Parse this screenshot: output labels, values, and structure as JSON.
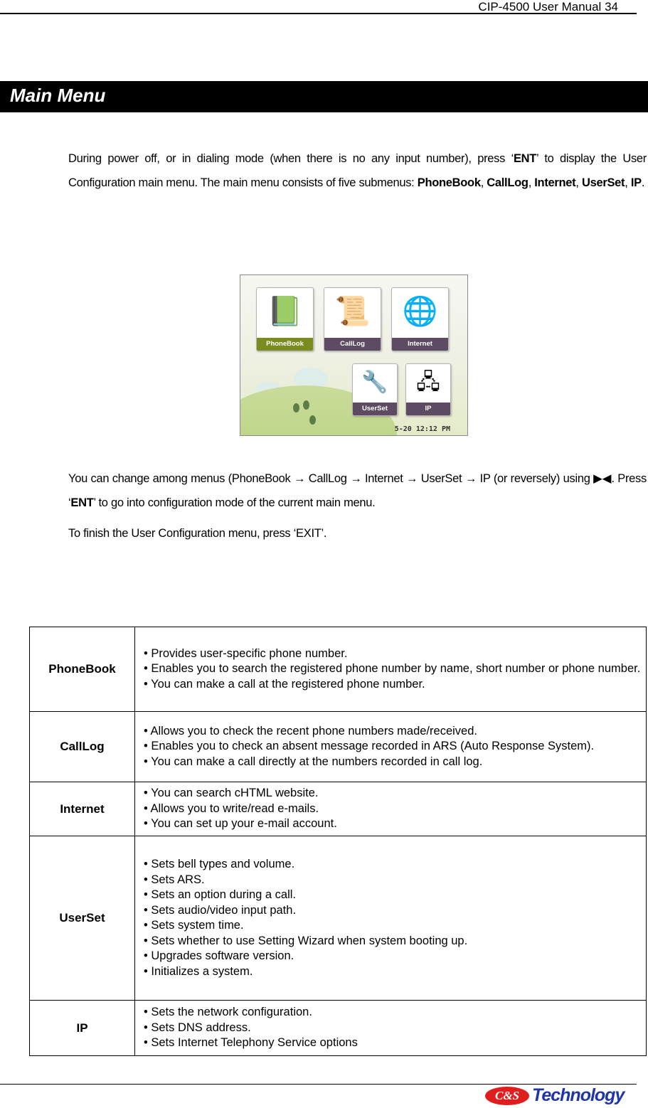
{
  "header": {
    "title": "CIP-4500 User Manual",
    "page_number": "34"
  },
  "section": {
    "title": "Main Menu"
  },
  "intro": {
    "part1": "During power off, or in dialing mode (when there is no any input number), press ‘",
    "key": "ENT",
    "part2": "’ to display the User Configuration main menu. The main menu consists of five submenus: ",
    "submenus": [
      "PhoneBook",
      "CallLog",
      "Internet",
      "UserSet",
      "IP"
    ],
    "sep": ", ",
    "end": "."
  },
  "screenshot": {
    "tiles": [
      {
        "label": "PhoneBook",
        "icon": "notebook-icon",
        "glyph": "📗",
        "active": true
      },
      {
        "label": "CallLog",
        "icon": "scroll-icon",
        "glyph": "📜",
        "active": false
      },
      {
        "label": "Internet",
        "icon": "globe-icon",
        "glyph": "🌐",
        "active": false
      },
      {
        "label": "UserSet",
        "icon": "wrench-icon",
        "glyph": "🔧",
        "active": false
      },
      {
        "label": "IP",
        "icon": "network-icon",
        "glyph": "🖧",
        "active": false
      }
    ],
    "clock": "5-20 12:12 PM",
    "colors": {
      "active_label": "#7a8c1e",
      "inactive_label": "#5c4b63"
    }
  },
  "navigation": {
    "part1": "You can change among menus (PhoneBook ",
    "arrow": "→",
    "seq": [
      "CallLog",
      "Internet",
      "UserSet"
    ],
    "part_ip": " IP (or reversely) using ",
    "nav_keys": "▶◀",
    "part2": ". Press ‘",
    "key": "ENT",
    "part3": "’ to go into configuration mode of the current main menu."
  },
  "exit_note": "To finish the User Configuration menu, press ‘EXIT’.",
  "table": {
    "bullet": "•",
    "rows": [
      {
        "name": "PhoneBook",
        "items": [
          "Provides user-specific phone number.",
          "Enables you to search the registered phone number by name, short number or phone number.",
          "You can make a call at the registered phone number."
        ]
      },
      {
        "name": "CallLog",
        "items": [
          "Allows you to check the recent phone numbers made/received.",
          "Enables you to check an absent message recorded in ARS (Auto Response System).",
          "You can make a call directly at the numbers recorded in call log."
        ]
      },
      {
        "name": "Internet",
        "items": [
          "You can search cHTML website.",
          "Allows you to write/read e-mails.",
          "You can set up your e-mail account."
        ]
      },
      {
        "name": "UserSet",
        "items": [
          "Sets bell types and volume.",
          "Sets ARS.",
          "Sets an option during a call.",
          "Sets audio/video input path.",
          "Sets system time.",
          "Sets whether to use Setting Wizard when system booting up.",
          "Upgrades software version.",
          "Initializes a system."
        ]
      },
      {
        "name": "IP",
        "items": [
          "Sets the network configuration.",
          "Sets DNS address.",
          "Sets Internet Telephony Service options"
        ]
      }
    ]
  },
  "footer": {
    "logo_badge": "C&S",
    "logo_text": "Technology",
    "colors": {
      "badge": "#e01e1e",
      "text": "#1f35a8"
    }
  }
}
